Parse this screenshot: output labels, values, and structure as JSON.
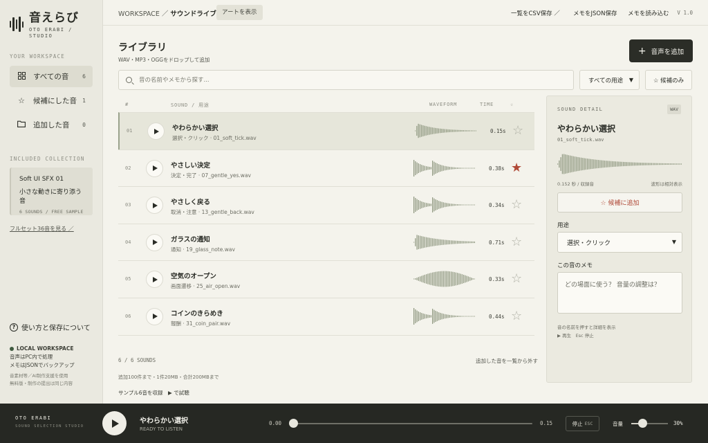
{
  "brand": {
    "title": "音えらび",
    "subtitle_line1": "OTO ERABI /",
    "subtitle_line2": "STUDIO"
  },
  "sidebar": {
    "workspace_label": "YOUR WORKSPACE",
    "nav": [
      {
        "label": "すべての音",
        "count": "6",
        "icon": "grid-icon",
        "active": true
      },
      {
        "label": "候補にした音",
        "count": "1",
        "icon": "star-icon",
        "active": false
      },
      {
        "label": "追加した音",
        "count": "0",
        "icon": "folder-icon",
        "active": false
      }
    ],
    "collection_label": "INCLUDED COLLECTION",
    "collection": {
      "name": "Soft UI SFX 01",
      "desc": "小さな動きに寄り添う音",
      "meta": "6 SOUNDS / FREE SAMPLE"
    },
    "full_set_link": "フルセット36音を見る ／",
    "help": "使い方と保存について",
    "local": {
      "head": "LOCAL WORKSPACE",
      "line1": "音声はPC内で処理",
      "line2": "メモはJSONでバックアップ",
      "fine1": "音素材等／AI制作支援を使用",
      "fine2": "無料版・制作の提出は同じ内容"
    }
  },
  "topbar": {
    "crumb_root": "WORKSPACE",
    "crumb_sep": "／",
    "crumb_current": "サウンドライブラリ",
    "chip": "アートを表示",
    "actions": [
      "一覧をCSV保存 ／",
      "メモをJSON保存",
      "メモを読み込む"
    ],
    "version": "V 1.0"
  },
  "library": {
    "title": "ライブラリ",
    "subtitle": "WAV・MP3・OGGをドロップして追加",
    "add_button": "音声を追加",
    "search_placeholder": "音の名前やメモから探す...",
    "filter_value": "すべての用途",
    "fav_only": "☆ 候補のみ",
    "columns": {
      "num": "#",
      "sound": "SOUND / 用途",
      "waveform": "WAVEFORM",
      "time": "TIME",
      "fav": "☆"
    },
    "rows": [
      {
        "idx": "01",
        "name": "やわらかい選択",
        "meta": "選択・クリック · 01_soft_tick.wav",
        "time": "0.15s",
        "fav": false,
        "selected": true,
        "shape": "decay"
      },
      {
        "idx": "02",
        "name": "やさしい決定",
        "meta": "決定・完了 · 07_gentle_yes.wav",
        "time": "0.38s",
        "fav": true,
        "selected": false,
        "shape": "double"
      },
      {
        "idx": "03",
        "name": "やさしく戻る",
        "meta": "取消・注意 · 13_gentle_back.wav",
        "time": "0.34s",
        "fav": false,
        "selected": false,
        "shape": "double"
      },
      {
        "idx": "04",
        "name": "ガラスの通知",
        "meta": "通知 · 19_glass_note.wav",
        "time": "0.71s",
        "fav": false,
        "selected": false,
        "shape": "long"
      },
      {
        "idx": "05",
        "name": "空気のオープン",
        "meta": "画面遷移 · 25_air_open.wav",
        "time": "0.33s",
        "fav": false,
        "selected": false,
        "shape": "swell"
      },
      {
        "idx": "06",
        "name": "コインのきらめき",
        "meta": "報酬 · 31_coin_pair.wav",
        "time": "0.44s",
        "fav": false,
        "selected": false,
        "shape": "double"
      }
    ],
    "count_text": "6 / 6 SOUNDS",
    "remove_link": "追加した音を一覧から外す",
    "limits": "追加100件まで・1件20MB・合計200MBまで",
    "sample_text": "サンプル6音を収録",
    "preview_text": "▶ で試聴"
  },
  "detail": {
    "label": "SOUND DETAIL",
    "badge": "WAV",
    "name": "やわらかい選択",
    "file": "01_soft_tick.wav",
    "info_left": "0.152 秒 / 収録音",
    "info_right": "波形は相対表示",
    "fav_button": "☆ 候補に追加",
    "usage_label": "用途",
    "usage_value": "選択・クリック",
    "memo_label": "この音のメモ",
    "memo_placeholder": "どの場面に使う？ 音量の調整は？",
    "hint1": "音の名前を押すと詳細を表示",
    "hint2": "▶ 再生　Esc 停止"
  },
  "player": {
    "brand": "OTO ERABI",
    "brand_sub": "SOUND SELECTION STUDIO",
    "track_name": "やわらかい選択",
    "status": "READY TO LISTEN",
    "time_start": "0.00",
    "time_end": "0.15",
    "progress": 0,
    "stop_label": "停止",
    "stop_key": "ESC",
    "volume_label": "音量",
    "volume": 0.3,
    "volume_text": "30%"
  },
  "colors": {
    "accent_dark": "#2b2d27",
    "fav_red": "#b04a38",
    "wave": "#8f9880"
  }
}
